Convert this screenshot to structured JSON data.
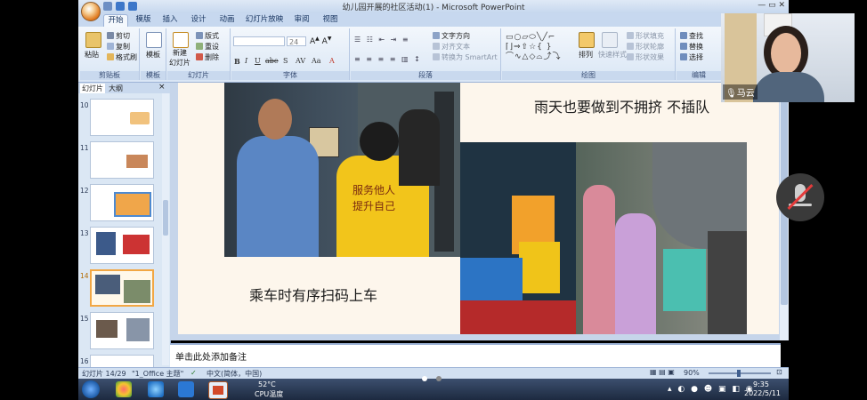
{
  "app": {
    "window_title": "幼儿园开展的社区活动(1) - Microsoft PowerPoint"
  },
  "ribbon": {
    "tabs": [
      "开始",
      "插入",
      "设计",
      "动画",
      "幻灯片放映",
      "审阅",
      "视图",
      "模版"
    ],
    "groups": {
      "clipboard": {
        "label": "剪贴板",
        "paste": "粘贴",
        "cut": "剪切",
        "copy": "复制",
        "format_painter": "格式刷"
      },
      "template": {
        "label": "模板",
        "template_btn": "模板"
      },
      "slides": {
        "label": "幻灯片",
        "new_slide": "新建",
        "new_slide_2": "幻灯片",
        "layout": "版式",
        "reset": "重设",
        "delete": "删除"
      },
      "font": {
        "label": "字体",
        "font_size": "24"
      },
      "paragraph": {
        "label": "段落",
        "text_direction": "文字方向",
        "align_text": "对齐文本",
        "smartart": "转换为 SmartArt"
      },
      "drawing": {
        "label": "绘图",
        "arrange": "排列",
        "quick_styles": "快速样式",
        "shape_fill": "形状填充",
        "shape_outline": "形状轮廓",
        "shape_effects": "形状效果"
      },
      "editing": {
        "label": "编辑",
        "find": "查找",
        "replace": "替换",
        "select": "选择"
      }
    }
  },
  "left_panel": {
    "tab_slides": "幻灯片",
    "tab_outline": "大纲",
    "close": "×",
    "slide_numbers": [
      "10",
      "11",
      "12",
      "13",
      "14",
      "15",
      "16"
    ],
    "selected": "14"
  },
  "slide": {
    "caption_left": "乘车时有序扫码上车",
    "caption_right": "雨天也要做到不拥挤 不插队",
    "vest_text_line1": "服务他人",
    "vest_text_line2": "提升自己"
  },
  "notes": {
    "placeholder": "单击此处添加备注"
  },
  "status_bar": {
    "slide_info": "幻灯片 14/29",
    "theme": "\"1_Office 主题\"",
    "language": "中文(简体，中国)",
    "zoom": "90%"
  },
  "taskbar": {
    "temp": "52°C",
    "cpu_label": "CPU温度",
    "time": "9:35",
    "date": "2022/5/11"
  },
  "video": {
    "participant_name": "马云"
  },
  "colors": {
    "ribbon_bg": "#dce8f6",
    "slide_bg": "#fdf6ec",
    "selected_thumb": "#f2a744",
    "taskbar": "#1d2a40"
  }
}
